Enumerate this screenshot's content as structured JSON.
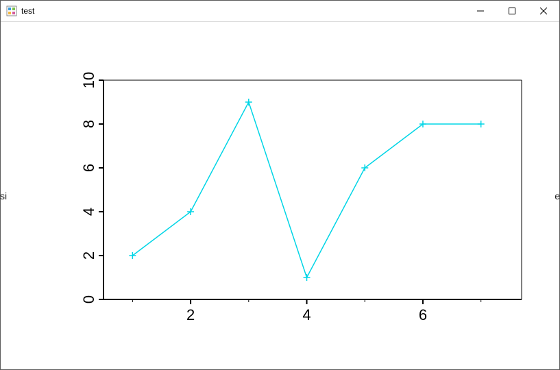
{
  "window": {
    "title": "test",
    "bg_left_fragment": "si",
    "bg_right_fragment": "e"
  },
  "chart_data": {
    "type": "line",
    "x": [
      1,
      2,
      3,
      4,
      5,
      6,
      7
    ],
    "values": [
      2,
      4,
      9,
      1,
      6,
      8,
      8
    ],
    "marker": "plus",
    "line_color": "#00d5e6",
    "title": "",
    "xlabel": "",
    "ylabel": "",
    "xlim": [
      0.5,
      7.7
    ],
    "ylim": [
      0,
      10
    ],
    "xticks": [
      2,
      4,
      6
    ],
    "yticks": [
      0,
      2,
      4,
      6,
      8,
      10
    ]
  }
}
